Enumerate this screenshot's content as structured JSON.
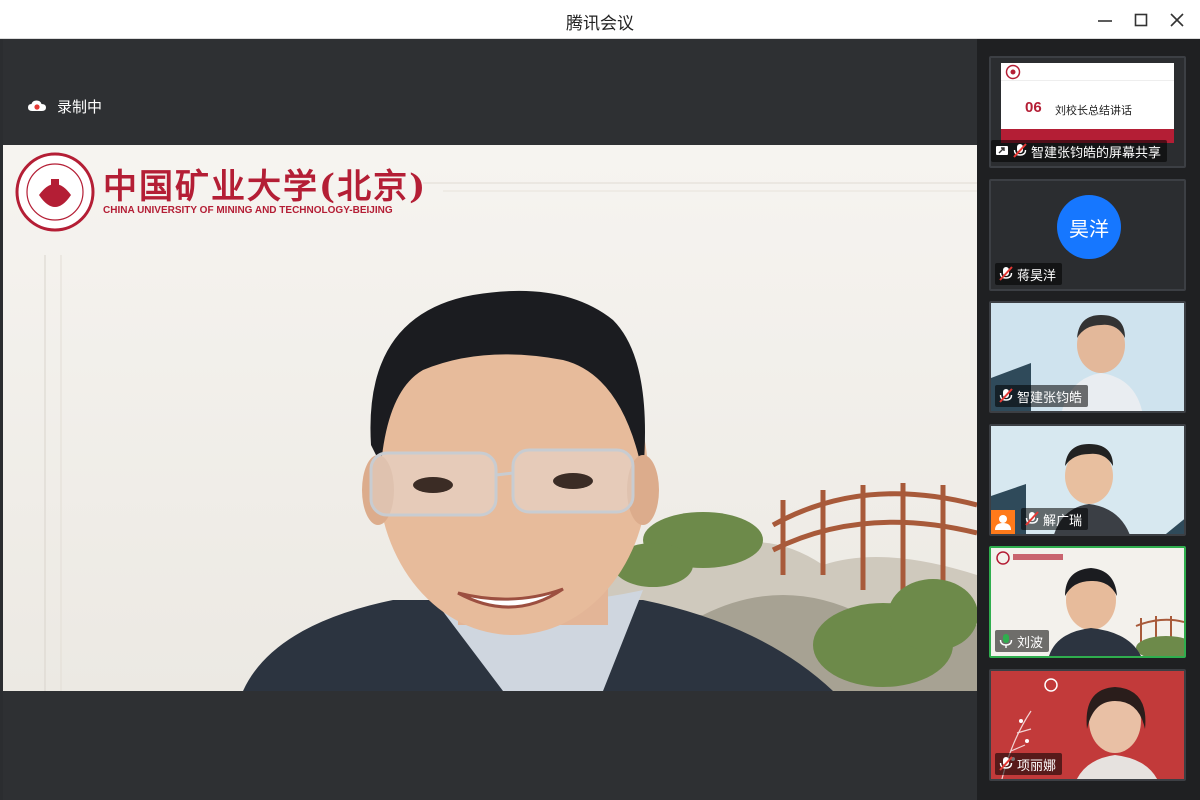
{
  "window": {
    "title": "腾讯会议"
  },
  "stage": {
    "recording_label": "录制中",
    "university_logo_text": "中国矿业大学(北京)",
    "university_english": "CHINA UNIVERSITY OF MINING AND TECHNOLOGY-BEIJING",
    "speaker_name": "刘波"
  },
  "participants": [
    {
      "name": "智建张钧皓的屏幕共享",
      "type": "screen_share",
      "slide_number": "06",
      "slide_title": "刘校长总结讲话",
      "mic": "muted"
    },
    {
      "name": "蒋昊洋",
      "type": "avatar",
      "avatar_text": "昊洋",
      "mic": "muted"
    },
    {
      "name": "智建张钧皓",
      "type": "video",
      "mic": "muted"
    },
    {
      "name": "解广瑞",
      "type": "video",
      "mic": "muted",
      "host_icon": true
    },
    {
      "name": "刘波",
      "type": "video",
      "mic": "on",
      "active": true
    },
    {
      "name": "项丽娜",
      "type": "video",
      "mic": "muted"
    }
  ],
  "colors": {
    "accent_green": "#2fae4e",
    "avatar_blue": "#1677ff",
    "host_orange": "#ff7a1a",
    "mute_red": "#e53935",
    "brand_red": "#b41e35"
  }
}
